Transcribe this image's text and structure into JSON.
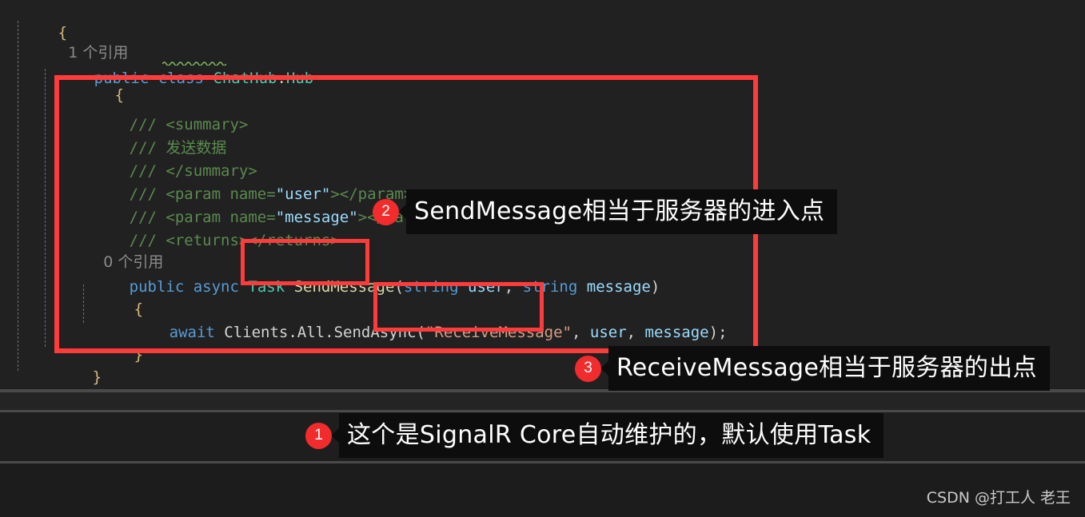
{
  "editor": {
    "background": "#212121",
    "lines": [
      {
        "id": "l0",
        "text": "{"
      },
      {
        "id": "l1",
        "text": "1 个引用"
      },
      {
        "id": "l2a",
        "text": "public class "
      },
      {
        "id": "l2b",
        "text": "ChatHub"
      },
      {
        "id": "l2c",
        "text": ":Hub"
      },
      {
        "id": "l3",
        "text": "{"
      },
      {
        "id": "l4",
        "text": "/// <summary>"
      },
      {
        "id": "l5",
        "text": "/// 发送数据"
      },
      {
        "id": "l6",
        "text": "/// </summary>"
      },
      {
        "id": "l7",
        "text": "/// <param name=\"user\"></param>"
      },
      {
        "id": "l8",
        "text": "/// <param name=\"message\"></param>"
      },
      {
        "id": "l9",
        "text": "/// <returns></returns>"
      },
      {
        "id": "l10",
        "text": "0 个引用"
      },
      {
        "id": "l11",
        "text": "public async Task SendMessage(string user, string message)"
      },
      {
        "id": "l12",
        "text": "{"
      },
      {
        "id": "l13",
        "text": "await Clients.All.SendAsync(\"ReceiveMessage\", user, message);"
      },
      {
        "id": "l14",
        "text": "}"
      },
      {
        "id": "l15",
        "text": "}"
      },
      {
        "id": "l16",
        "text": "}"
      }
    ],
    "tokens": {
      "brace_open": "{",
      "brace_close": "}",
      "ref_one": "1 个引用",
      "ref_zero": "0 个引用",
      "kw_public": "public",
      "kw_class": "class",
      "kw_async": "async",
      "kw_await": "await",
      "kw_string": "string",
      "type_task": "Task",
      "type_chathub": "ChatHub",
      "type_hub": "Hub",
      "colon": ":",
      "cmt_slashes": "///",
      "cmt_summary_open": "<summary>",
      "cmt_summary_text": "发送数据",
      "cmt_summary_close": "</summary>",
      "cmt_param_open": "<param name=",
      "cmt_param_user": "\"user\"",
      "cmt_param_message": "\"message\"",
      "cmt_param_gt": ">",
      "cmt_param_close": "</param>",
      "cmt_returns": "<returns></returns>",
      "method_sendmessage": "SendMessage",
      "paren_open": "(",
      "paren_close": ")",
      "param_user": "user",
      "param_message": "message",
      "comma": ", ",
      "clients_chain": "Clients.All.SendAsync",
      "str_receivemessage": "\"ReceiveMessage\"",
      "semicolon": ";"
    }
  },
  "annotations": {
    "box_color": "#ff3b3b",
    "items": [
      {
        "number": "1",
        "text": "这个是SignalR Core自动维护的，默认使用Task",
        "name": "callout-signalr-task"
      },
      {
        "number": "2",
        "text": "SendMessage相当于服务器的进入点",
        "name": "callout-sendmessage-entry"
      },
      {
        "number": "3",
        "text": "ReceiveMessage相当于服务器的出点",
        "name": "callout-receivemessage-exit"
      }
    ]
  },
  "watermark": {
    "text": "CSDN @打工人 老王"
  }
}
